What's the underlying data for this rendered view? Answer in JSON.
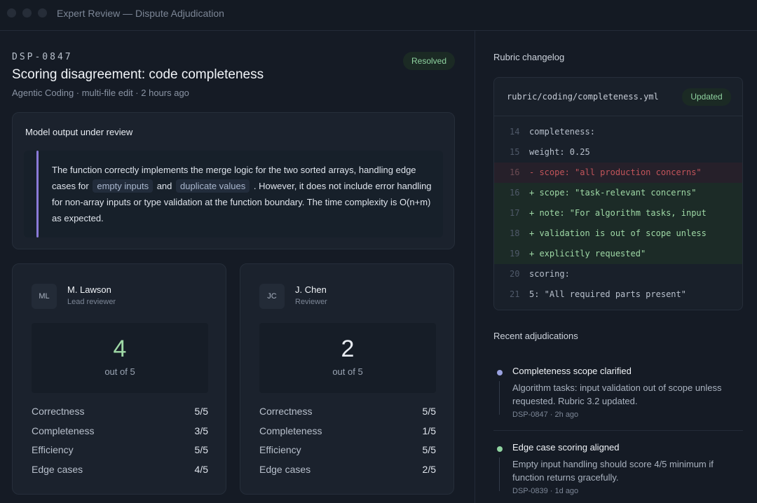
{
  "window": {
    "title": "Expert Review — Dispute Adjudication"
  },
  "dispute": {
    "id": "DSP-0847",
    "status": "Resolved",
    "title": "Scoring disagreement: code completeness",
    "subtitle": "Agentic Coding · multi-file edit · 2 hours ago"
  },
  "model_output": {
    "heading": "Model output under review",
    "text_before": "The function correctly implements the merge logic for the two sorted arrays, handling edge cases for",
    "chip1": "empty inputs",
    "text_and": "and",
    "chip2": "duplicate values",
    "text_after": ". However, it does not include error handling for non-array inputs or type validation at the function boundary. The time complexity is O(n+m) as expected."
  },
  "reviewers": [
    {
      "initials": "ML",
      "name": "M. Lawson",
      "role": "Lead reviewer",
      "score": "4",
      "out_of": "out of 5",
      "score_color": "#9fd9a6",
      "criteria": [
        {
          "label": "Correctness",
          "value": "5/5"
        },
        {
          "label": "Completeness",
          "value": "3/5"
        },
        {
          "label": "Efficiency",
          "value": "5/5"
        },
        {
          "label": "Edge cases",
          "value": "4/5"
        }
      ]
    },
    {
      "initials": "JC",
      "name": "J. Chen",
      "role": "Reviewer",
      "score": "2",
      "out_of": "out of 5",
      "score_color": "#e8ecf2",
      "criteria": [
        {
          "label": "Correctness",
          "value": "5/5"
        },
        {
          "label": "Completeness",
          "value": "1/5"
        },
        {
          "label": "Efficiency",
          "value": "5/5"
        },
        {
          "label": "Edge cases",
          "value": "2/5"
        }
      ]
    }
  ],
  "changelog": {
    "heading": "Rubric changelog",
    "file": "rubric/coding/completeness.yml",
    "badge": "Updated",
    "lines": [
      {
        "n": "14",
        "text": "completeness:",
        "kind": "ctx"
      },
      {
        "n": "15",
        "text": "weight: 0.25",
        "kind": "ctx"
      },
      {
        "n": "16",
        "text": "- scope: \"all production concerns\"",
        "kind": "del"
      },
      {
        "n": "16",
        "text": "+ scope: \"task-relevant concerns\"",
        "kind": "add"
      },
      {
        "n": "17",
        "text": "+ note: \"For algorithm tasks, input",
        "kind": "add"
      },
      {
        "n": "18",
        "text": "+ validation is out of scope unless",
        "kind": "add"
      },
      {
        "n": "19",
        "text": "+ explicitly requested\"",
        "kind": "add"
      },
      {
        "n": "20",
        "text": "scoring:",
        "kind": "ctx"
      },
      {
        "n": "21",
        "text": "5: \"All required parts present\"",
        "kind": "ctx"
      }
    ]
  },
  "recent": {
    "heading": "Recent adjudications",
    "items": [
      {
        "title": "Completeness scope clarified",
        "desc": "Algorithm tasks: input validation out of scope unless requested. Rubric 3.2 updated.",
        "meta": "DSP-0847 · 2h ago",
        "dot_color": "#9aa2e0"
      },
      {
        "title": "Edge case scoring aligned",
        "desc": "Empty input handling should score 4/5 minimum if function returns gracefully.",
        "meta": "DSP-0839 · 1d ago",
        "dot_color": "#8fd3a0"
      }
    ]
  }
}
